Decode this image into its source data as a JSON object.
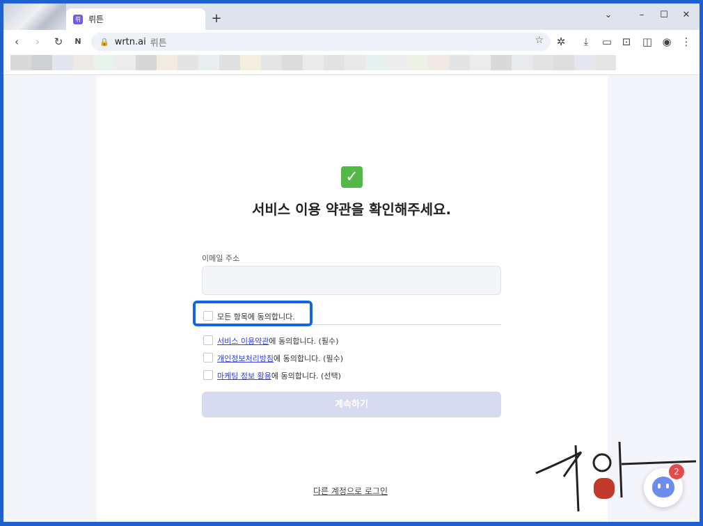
{
  "browser": {
    "tab_title": "뤼튼",
    "tab_favicon": "뤼",
    "new_tab": "+",
    "url": "wrtn.ai",
    "url_title": "뤼튼",
    "icons": [
      "back-icon",
      "forward-icon",
      "reload-icon",
      "naver-icon",
      "lock-icon",
      "star-icon",
      "extensions-icon",
      "download-icon",
      "cast-icon",
      "screenshot-icon",
      "sidebar-icon",
      "profile-icon",
      "menu-icon"
    ]
  },
  "page": {
    "heading": "서비스 이용 약관을 확인해주세요.",
    "email_label": "이메일 주소",
    "email_value": "",
    "agree_all": "모든 항목에 동의합니다.",
    "terms": [
      {
        "link": "서비스 이용약관",
        "suffix": "에 동의합니다. (필수)"
      },
      {
        "link": "개인정보처리방침",
        "suffix": "에 동의합니다. (필수)"
      },
      {
        "link": "마케팅 정보 활용",
        "suffix": "에 동의합니다. (선택)"
      }
    ],
    "continue_button": "계속하기",
    "other_login": "다른 계정으로 로그인"
  },
  "chat": {
    "badge_count": "2"
  },
  "colors": {
    "frame_blue": "#1f5fcf",
    "highlight_blue": "#1565e8",
    "link_blue": "#2b3ee0",
    "check_green": "#54b848",
    "button_disabled": "#d7dbef"
  }
}
